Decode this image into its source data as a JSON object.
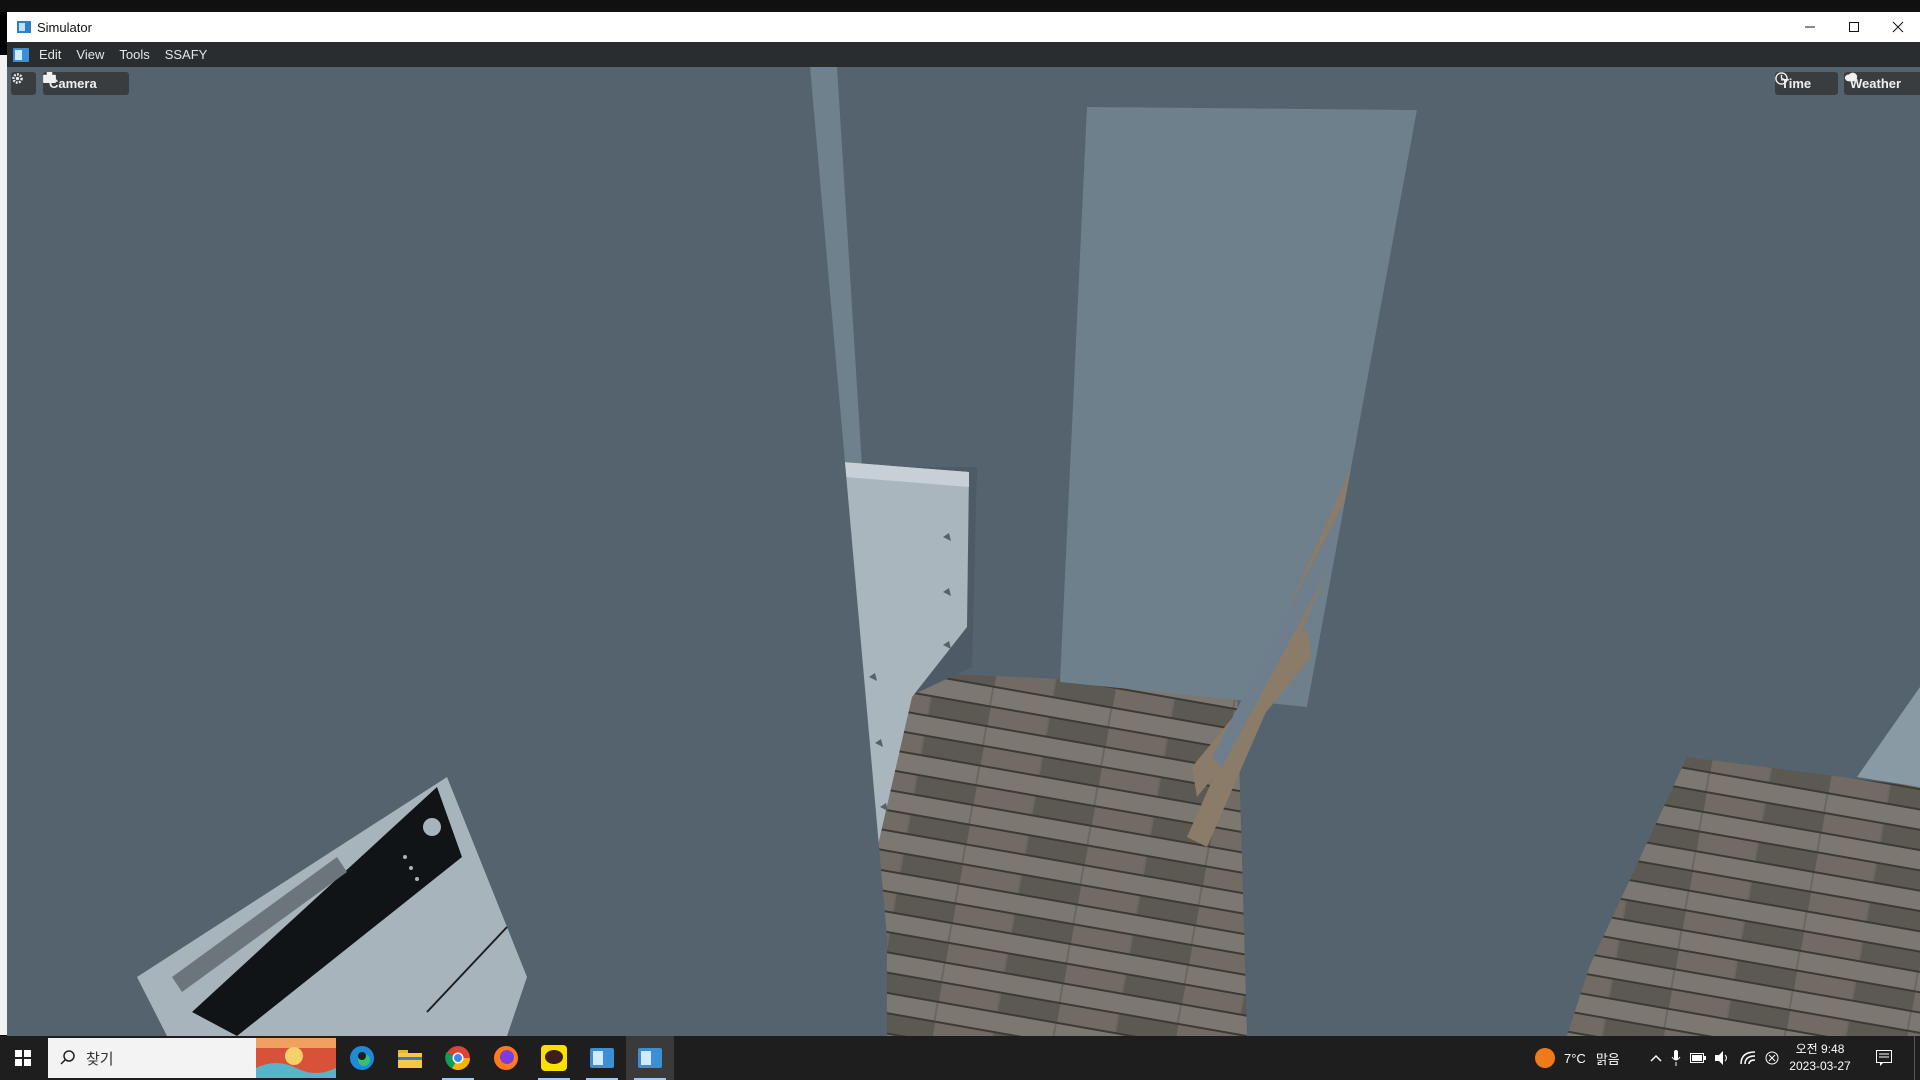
{
  "window": {
    "title": "Simulator",
    "controls": {
      "minimize": "─",
      "maximize": "☐",
      "close": "✕"
    }
  },
  "menu": {
    "items": [
      "Edit",
      "View",
      "Tools",
      "SSAFY"
    ]
  },
  "toolbar": {
    "settings_icon": "gear-icon",
    "camera_label": "Camera",
    "time_label": "Time",
    "weather_label": "Weather"
  },
  "taskbar": {
    "search_placeholder": "찾기",
    "weather_temp": "7°C",
    "weather_desc": "맑음",
    "time": "오전 9:48",
    "date": "2023-03-27"
  },
  "colors": {
    "wall": "#55636f",
    "menu_bg": "#2a2d30",
    "taskbar_bg": "#1e1e1e",
    "accent": "#9ac8ff"
  }
}
